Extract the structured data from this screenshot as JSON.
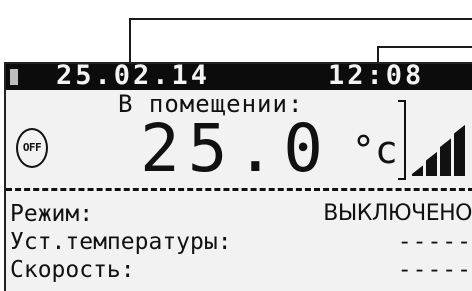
{
  "status_bar": {
    "date": "25.02.14",
    "time": "12:08"
  },
  "display": {
    "room_label": "В помещении:",
    "temperature": "25.0",
    "temperature_unit": "°c",
    "power_state": "OFF",
    "signal_level": 4,
    "signal_max": 4
  },
  "info": {
    "mode_label": "Режим:",
    "mode_value": "ВЫКЛЮЧЕНО",
    "setpoint_label": "Уст.температуры:",
    "setpoint_value": "-----",
    "speed_label": "Скорость:",
    "speed_value": "-----"
  },
  "colors": {
    "lcd_background": "#f2f2f2",
    "lcd_foreground": "#111111",
    "status_bar_background": "#0c0c0c"
  }
}
